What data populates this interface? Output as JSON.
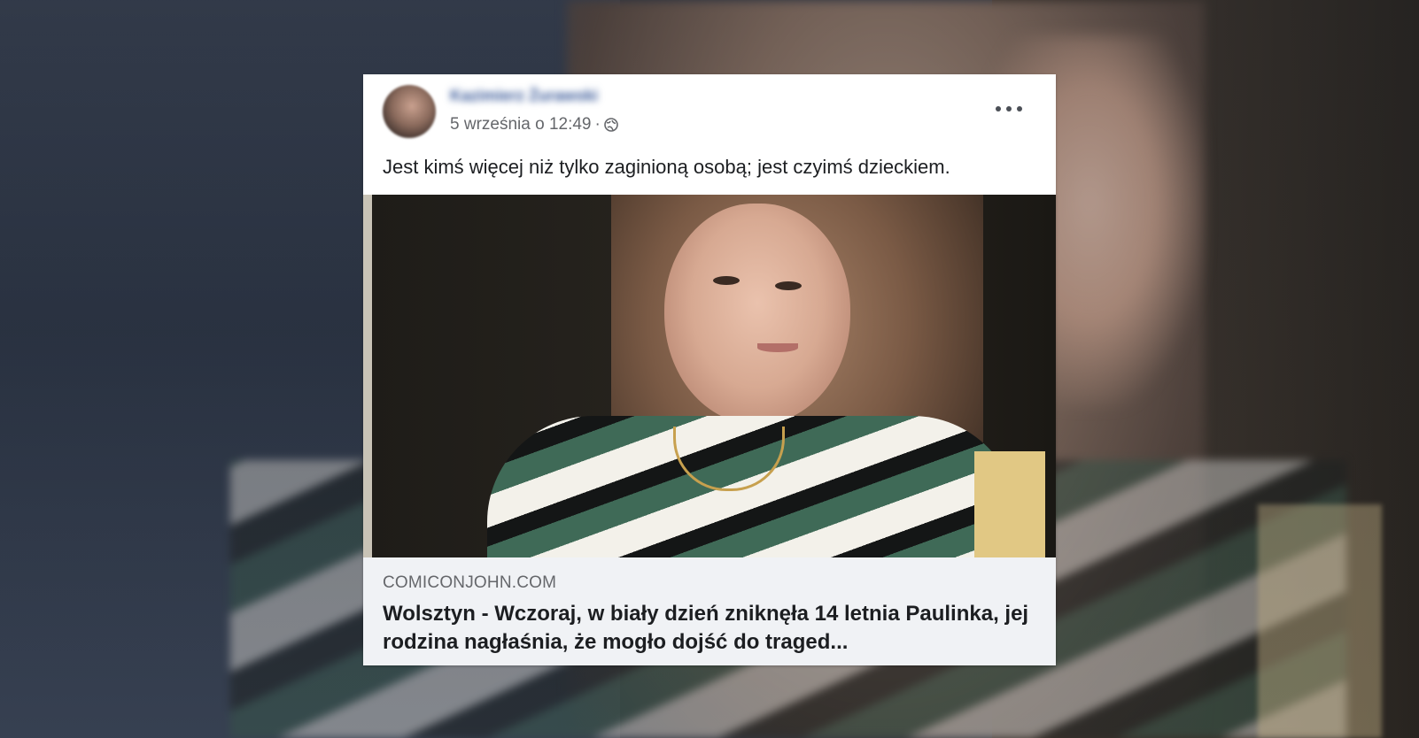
{
  "post": {
    "author_name": "Kazimierz Żurawski",
    "timestamp": "5 września o 12:49",
    "separator": "·",
    "privacy_icon": "globe-icon",
    "more_icon": "more-options-icon",
    "caption": "Jest kimś więcej niż tylko zaginioną osobą; jest czyimś dzieckiem.",
    "link_preview": {
      "domain": "COMICONJOHN.COM",
      "title": "Wolsztyn - Wczoraj, w biały dzień zniknęła 14 letnia Paulinka, jej rodzina nagłaśnia, że mogło dojść do traged..."
    }
  },
  "colors": {
    "author_link": "#385898",
    "meta_text": "#65676b",
    "body_text": "#1c1e21",
    "preview_bg": "#f0f2f5"
  }
}
